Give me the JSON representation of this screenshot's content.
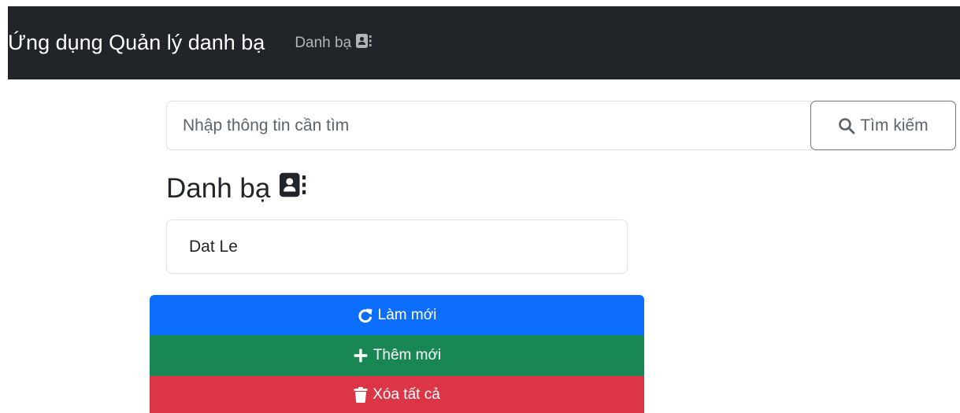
{
  "navbar": {
    "brand": "Ứng dụng Quản lý danh bạ",
    "link_label": "Danh bạ",
    "link_icon": "contact-book-icon"
  },
  "search": {
    "placeholder": "Nhập thông tin cần tìm",
    "value": "",
    "button_label": "Tìm kiếm",
    "button_icon": "search-icon"
  },
  "contacts": {
    "heading": "Danh bạ",
    "heading_icon": "contact-book-icon",
    "items": [
      {
        "name": "Dat Le"
      }
    ]
  },
  "actions": {
    "refresh_label": "Làm mới",
    "refresh_icon": "refresh-icon",
    "add_label": "Thêm mới",
    "add_icon": "plus-icon",
    "delete_all_label": "Xóa tất cả",
    "delete_icon": "trash-icon"
  },
  "colors": {
    "navbar_bg": "#212529",
    "primary": "#0d6efd",
    "success": "#198754",
    "danger": "#dc3545",
    "secondary": "#6c757d"
  }
}
